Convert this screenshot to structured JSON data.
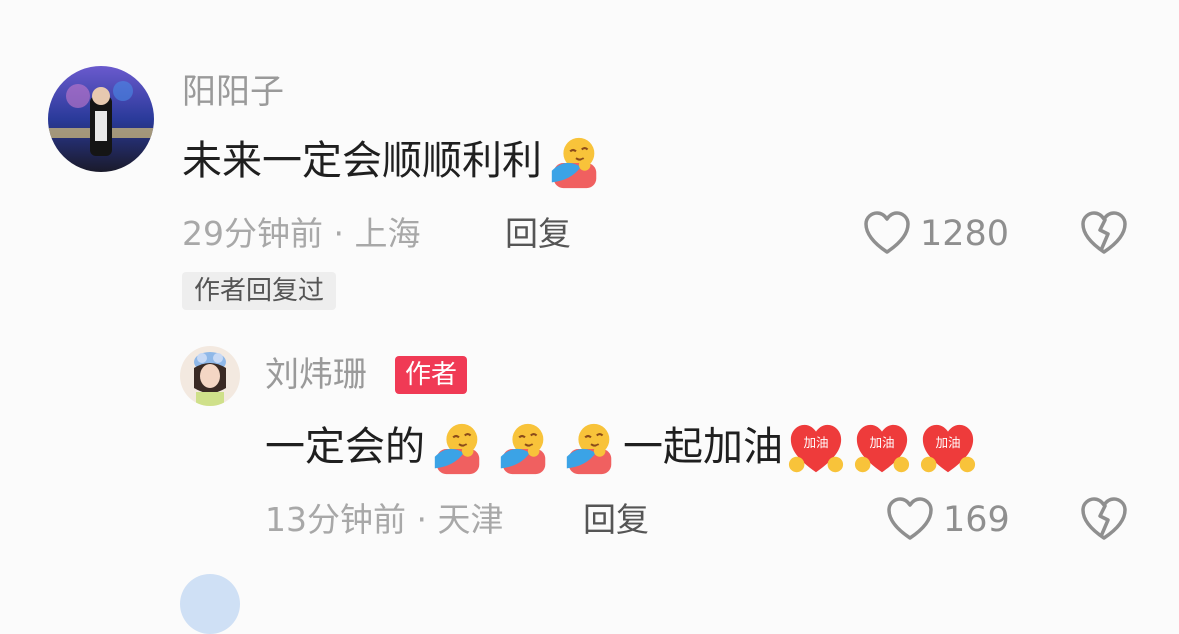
{
  "comments": [
    {
      "username": "阳阳子",
      "text": "未来一定会顺顺利利",
      "emoji": "hug-emoji",
      "time": "29分钟前",
      "separator": "·",
      "location": "上海",
      "reply_label": "回复",
      "likes": "1280",
      "author_replied_chip": "作者回复过"
    }
  ],
  "reply": {
    "username": "刘炜珊",
    "badge": "作者",
    "text_part1": "一定会的",
    "text_part2": "一起加油",
    "emoji_hug": "hug-emoji",
    "emoji_jiayou": "jiayou-heart-emoji",
    "jiayou_label": "加油",
    "time": "13分钟前",
    "separator": "·",
    "location": "天津",
    "reply_label": "回复",
    "likes": "169"
  },
  "colors": {
    "badge": "#f03a55",
    "muted": "#a8a8a8",
    "text": "#1f1f1f",
    "icon": "#8f8f8f"
  }
}
